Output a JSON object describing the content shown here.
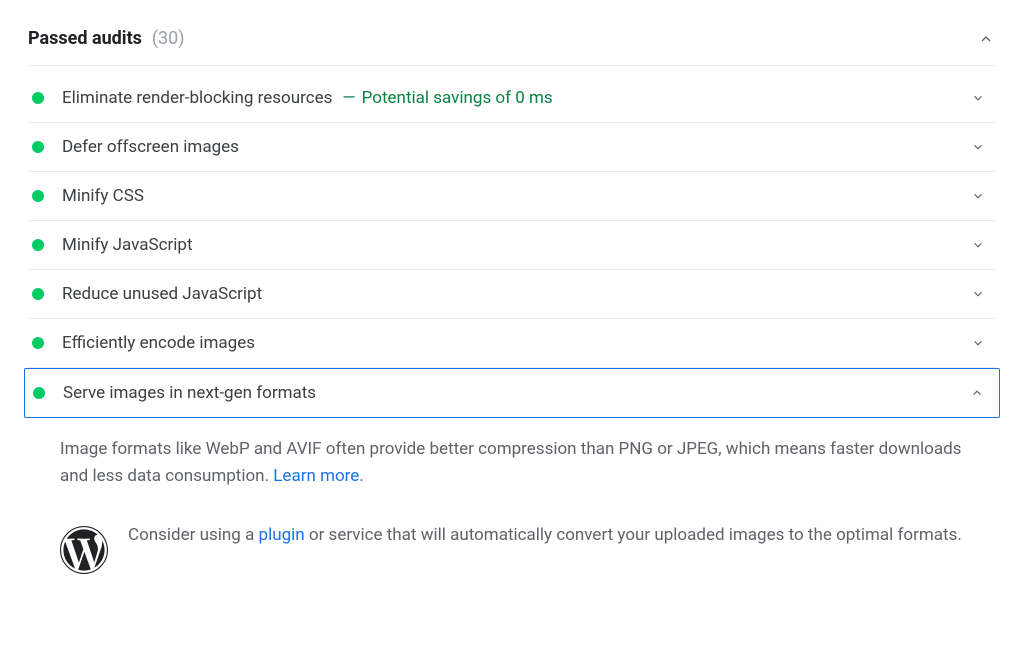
{
  "header": {
    "title": "Passed audits",
    "count": "(30)"
  },
  "audits": [
    {
      "title": "Eliminate render-blocking resources",
      "savings": "Potential savings of 0 ms"
    },
    {
      "title": "Defer offscreen images"
    },
    {
      "title": "Minify CSS"
    },
    {
      "title": "Minify JavaScript"
    },
    {
      "title": "Reduce unused JavaScript"
    },
    {
      "title": "Efficiently encode images"
    },
    {
      "title": "Serve images in next-gen formats",
      "expanded": true
    }
  ],
  "detail": {
    "text_before": "Image formats like WebP and AVIF often provide better compression than PNG or JPEG, which means faster downloads and less data consumption. ",
    "learn_more": "Learn more",
    "period": "."
  },
  "suggestion": {
    "before": "Consider using a ",
    "plugin_link": "plugin",
    "after": " or service that will automatically convert your uploaded images to the optimal formats."
  },
  "separator": "—"
}
